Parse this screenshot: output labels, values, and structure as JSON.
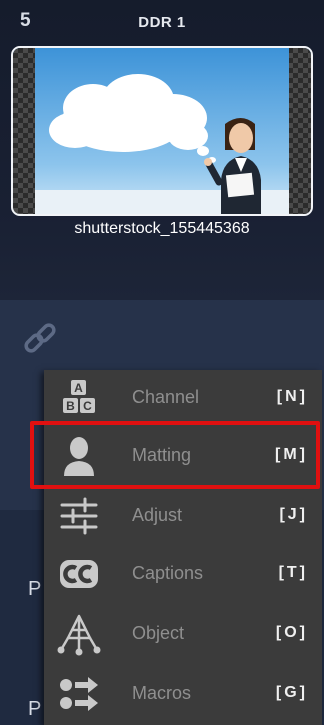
{
  "slot": {
    "number": "5",
    "title": "DDR 1",
    "file_label": "shutterstock_155445368"
  },
  "side_letters": [
    "P",
    "P"
  ],
  "menu": {
    "items": [
      {
        "label": "Channel",
        "key": "[N]",
        "icon": "channel-abc-icon"
      },
      {
        "label": "Matting",
        "key": "[M]",
        "icon": "person-silhouette-icon"
      },
      {
        "label": "Adjust",
        "key": "[J]",
        "icon": "sliders-icon"
      },
      {
        "label": "Captions",
        "key": "[T]",
        "icon": "cc-icon"
      },
      {
        "label": "Object",
        "key": "[O]",
        "icon": "object-icon"
      },
      {
        "label": "Macros",
        "key": "[G]",
        "icon": "macros-icon"
      }
    ],
    "highlighted": "Matting"
  },
  "colors": {
    "highlight_border": "#e01010",
    "menu_bg": "#3b3b3b",
    "panel_bg": "#1b2233"
  }
}
